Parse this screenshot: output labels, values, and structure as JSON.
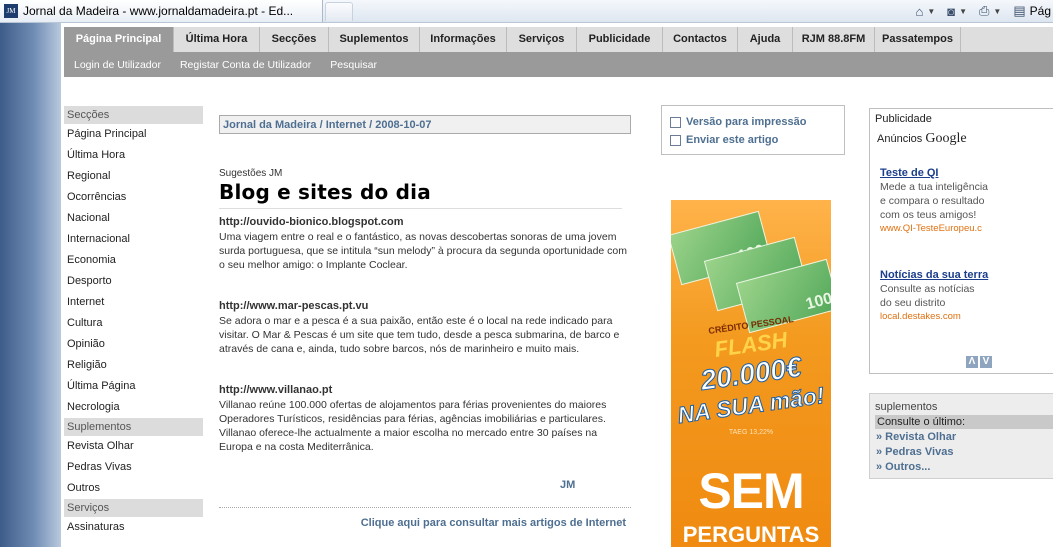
{
  "browser": {
    "tab_title": "Jornal da Madeira - www.jornaldamadeira.pt - Ed...",
    "page_menu_label": "Pág",
    "icons": [
      "home-icon",
      "rss-icon",
      "print-icon",
      "page-icon"
    ]
  },
  "nav": {
    "main": [
      "Página Principal",
      "Última Hora",
      "Secções",
      "Suplementos",
      "Informações",
      "Serviços",
      "Publicidade",
      "Contactos",
      "Ajuda",
      "RJM 88.8FM",
      "Passatempos"
    ],
    "active_index": 0,
    "sub": [
      "Login de Utilizador",
      "Registar Conta de Utilizador",
      "Pesquisar"
    ]
  },
  "sidebar": {
    "sections_header": "Secções",
    "sections": [
      "Página Principal",
      "Última Hora",
      "Regional",
      "Ocorrências",
      "Nacional",
      "Internacional",
      "Economia",
      "Desporto",
      "Internet",
      "Cultura",
      "Opinião",
      "Religião",
      "Última Página",
      "Necrologia"
    ],
    "supplements_header": "Suplementos",
    "supplements": [
      "Revista Olhar",
      "Pedras Vivas",
      "Outros"
    ],
    "services_header": "Serviços",
    "services": [
      "Assinaturas"
    ]
  },
  "article": {
    "breadcrumb": "Jornal da Madeira / Internet / 2008-10-07",
    "kicker": "Sugestões JM",
    "headline": "Blog e sites do dia",
    "entries": [
      {
        "url": "http://ouvido-bionico.blogspot.com",
        "text": "Uma viagem entre o real e o fantástico, as novas descobertas sonoras de uma jovem surda portuguesa, que se intitula “sun melody” à procura da segunda oportunidade com o seu melhor amigo: o Implante Coclear."
      },
      {
        "url": "http://www.mar-pescas.pt.vu",
        "text": "Se adora o mar e a pesca é a sua paixão, então este é o local na rede indicado para visitar. O Mar & Pescas é um site que tem tudo, desde a pesca submarina, de barco e através de cana e, ainda, tudo sobre barcos, nós de marinheiro e muito mais."
      },
      {
        "url": "http://www.villanao.pt",
        "text": "Villanao reúne 100.000 ofertas de alojamentos para férias provenientes do maiores Operadores Turísticos, residências para férias, agências imobiliárias e particulares. Villanao oferece-lhe actualmente a maior escolha no mercado entre 30 países na Europa e na costa Mediterrânica."
      }
    ],
    "author": "JM",
    "more_link": "Clique aqui para consultar mais artigos de Internet"
  },
  "tools": {
    "print": "Versão para impressão",
    "send": "Enviar este artigo"
  },
  "banner": {
    "small": "CRÉDITO PESSOAL",
    "flash": "FLASH",
    "amount": "20.000€",
    "hand": "NA SUA mão!",
    "taeg": "TAEG 13,22%",
    "sem": "SEM",
    "perguntas": "PERGUNTAS",
    "note_value": "100"
  },
  "publicity": {
    "title": "Publicidade",
    "anuncios": "Anúncios",
    "google": "Google",
    "ads": [
      {
        "title": "Teste de QI",
        "desc": [
          "Mede a tua inteligência",
          "e compara o resultado",
          "com os teus amigos!"
        ],
        "url": "www.QI-TesteEuropeu.c"
      },
      {
        "title": "Notícias da sua terra",
        "desc": [
          "Consulte as notícias",
          "do seu distrito"
        ],
        "url": "local.destakes.com"
      }
    ],
    "prev": "Λ",
    "next": "V"
  },
  "supplements_box": {
    "title": "suplementos",
    "caption": "Consulte o último:",
    "links": [
      "» Revista Olhar",
      "» Pedras Vivas",
      "» Outros..."
    ]
  },
  "colors": {
    "link": "#4e6f91",
    "nav_active": "#9a9a9a",
    "ad_orange": "#f39a1f"
  }
}
